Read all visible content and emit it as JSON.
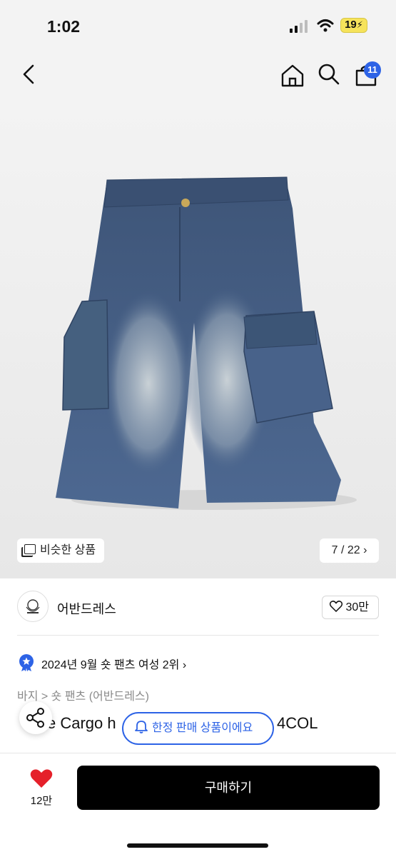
{
  "status": {
    "time": "1:02",
    "battery": "19"
  },
  "header": {
    "cart_count": "11"
  },
  "gallery": {
    "similar_label": "비슷한 상품",
    "pager": "7 / 22"
  },
  "brand": {
    "name": "어반드레스",
    "likes": "30만"
  },
  "product": {
    "rank": "2024년 9월 숏 팬츠 여성 2위",
    "breadcrumb": "바지 > 숏 팬츠 (어반드레스)",
    "title_left": "e Cargo h",
    "title_right": "4COL",
    "limited_label": "한정 판매 상품이에요"
  },
  "bottom": {
    "wish_count": "12만",
    "buy_label": "구매하기"
  },
  "colors": {
    "accent": "#2d63e6",
    "heart": "#e5202a",
    "denim": "#4a6388"
  }
}
